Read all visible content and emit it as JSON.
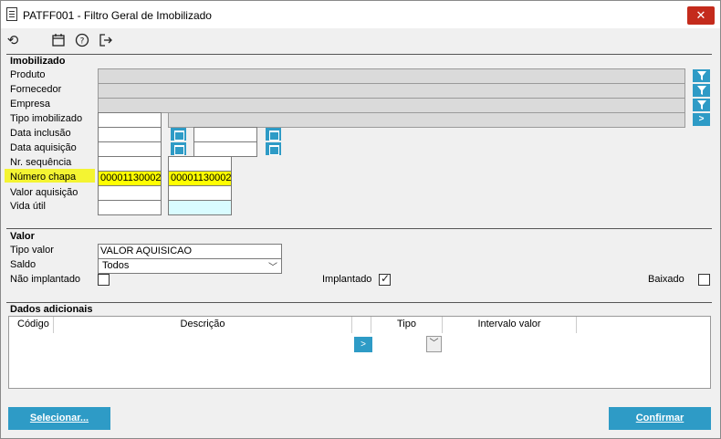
{
  "window": {
    "title": "PATFF001 - Filtro Geral de Imobilizado",
    "close_label": "✕"
  },
  "toolbar": {
    "icons": [
      "undo-icon",
      "calendar-icon",
      "help-icon",
      "exit-icon"
    ]
  },
  "imobilizado": {
    "section_title": "Imobilizado",
    "produto_label": "Produto",
    "fornecedor_label": "Fornecedor",
    "empresa_label": "Empresa",
    "tipo_imobilizado_label": "Tipo imobilizado",
    "data_inclusao_label": "Data inclusão",
    "data_aquisicao_label": "Data aquisição",
    "nr_sequencia_label": "Nr. sequência",
    "numero_chapa_label": "Número chapa",
    "valor_aquisicao_label": "Valor aquisição",
    "vida_util_label": "Vida útil",
    "numero_chapa_from": "00001130002",
    "numero_chapa_to": "00001130002",
    "arrow_label": ">"
  },
  "valor": {
    "section_title": "Valor",
    "tipo_valor_label": "Tipo valor",
    "tipo_valor_value": "VALOR AQUISICAO",
    "saldo_label": "Saldo",
    "saldo_value": "Todos",
    "nao_implantado_label": "Não implantado",
    "nao_implantado_checked": false,
    "implantado_label": "Implantado",
    "implantado_checked": true,
    "baixado_label": "Baixado",
    "baixado_checked": false
  },
  "dados_adicionais": {
    "section_title": "Dados adicionais",
    "columns": [
      "Código",
      "Descrição",
      "Tipo",
      "Intervalo valor"
    ],
    "row_button_label": ">"
  },
  "footer": {
    "selecionar_label": "Selecionar...",
    "confirmar_label": "Confirmar"
  },
  "colors": {
    "accent": "#2e9bc6",
    "highlight": "#f4f432",
    "close": "#c42b1c"
  }
}
